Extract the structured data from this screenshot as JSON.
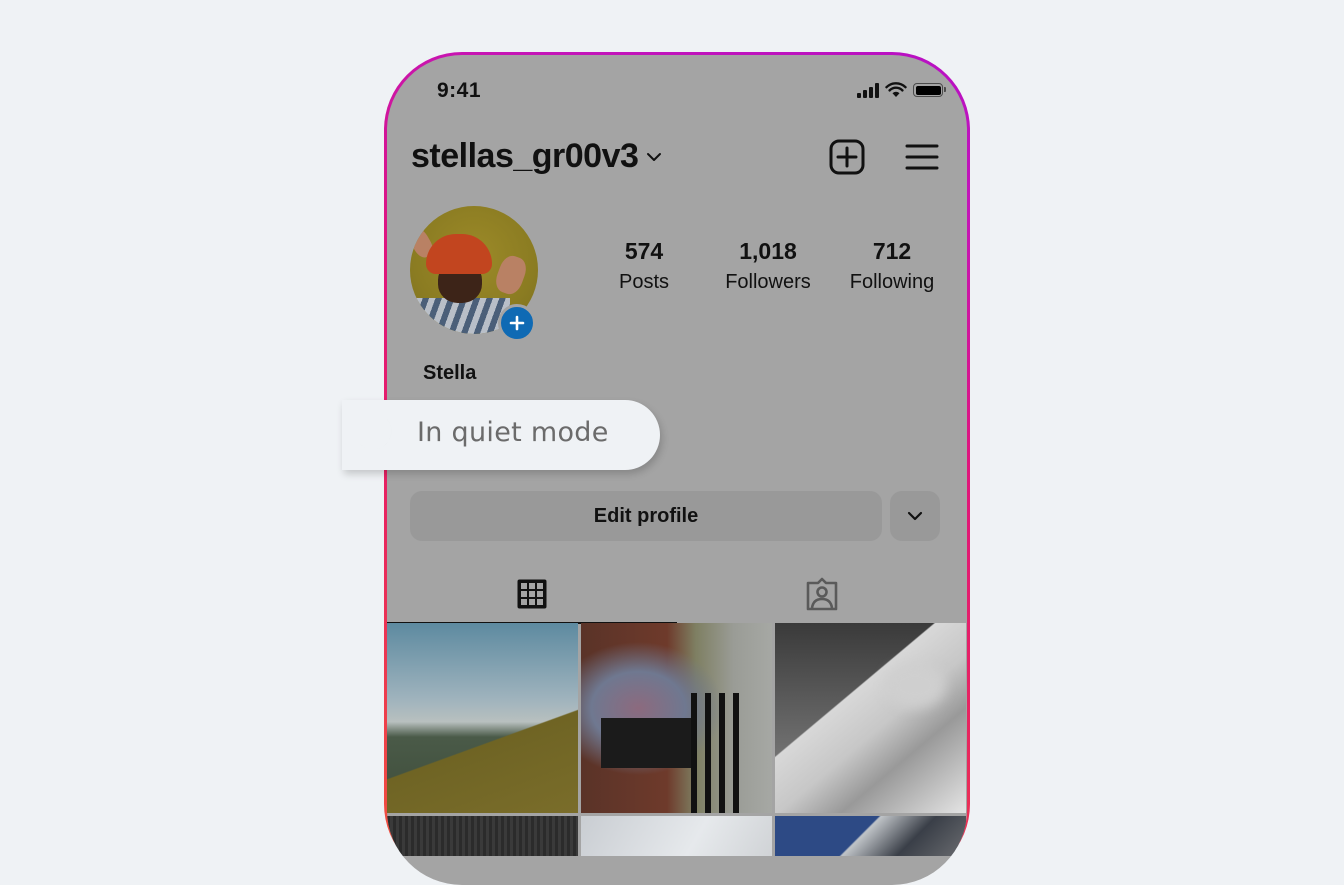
{
  "status_bar": {
    "time": "9:41"
  },
  "profile": {
    "username": "stellas_gr00v3",
    "display_name": "Stella",
    "stats": [
      {
        "value": "574",
        "label": "Posts"
      },
      {
        "value": "1,018",
        "label": "Followers"
      },
      {
        "value": "712",
        "label": "Following"
      }
    ]
  },
  "actions": {
    "edit_profile": "Edit profile"
  },
  "quiet_mode": {
    "label": "In quiet mode"
  },
  "tabs": [
    {
      "name": "grid",
      "icon": "grid-icon",
      "active": true
    },
    {
      "name": "tagged",
      "icon": "tagged-person-icon",
      "active": false
    }
  ],
  "posts": [
    {
      "subject": "hillside landscape"
    },
    {
      "subject": "street flower planter"
    },
    {
      "subject": "building cornice black and white"
    },
    {
      "subject": "dark texture"
    },
    {
      "subject": "light architecture"
    },
    {
      "subject": "blue structure"
    }
  ],
  "colors": {
    "page_background": "#eff2f5",
    "screen_dimmed": "#a4a4a4",
    "border_gradient": [
      "#f2553a",
      "#e0157c",
      "#b710c4"
    ],
    "story_add_badge": "#0f6ab4"
  }
}
